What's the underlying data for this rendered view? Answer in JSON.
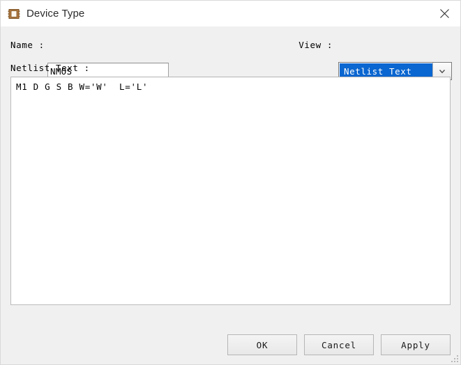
{
  "window": {
    "title": "Device Type",
    "icon": "device-chip-icon",
    "close_label": "✕"
  },
  "form": {
    "name": {
      "label": "Name :",
      "value": "NMOS",
      "placeholder": ""
    },
    "view": {
      "label": "View :",
      "selected": "Netlist Text",
      "options": [
        "Netlist Text"
      ],
      "arrow_icon": "chevron-down-icon",
      "highlight_color": "#0a66d0"
    },
    "netlist": {
      "label": "Netlist Text :",
      "value": "M1 D G S B W='W'  L='L'",
      "placeholder": ""
    }
  },
  "buttons": {
    "ok": "OK",
    "cancel": "Cancel",
    "apply": "Apply"
  },
  "colors": {
    "dialog_background": "#f0f0f0",
    "titlebar_background": "#ffffff",
    "field_background": "#ffffff",
    "accent": "#0a66d0",
    "text": "#000000"
  }
}
